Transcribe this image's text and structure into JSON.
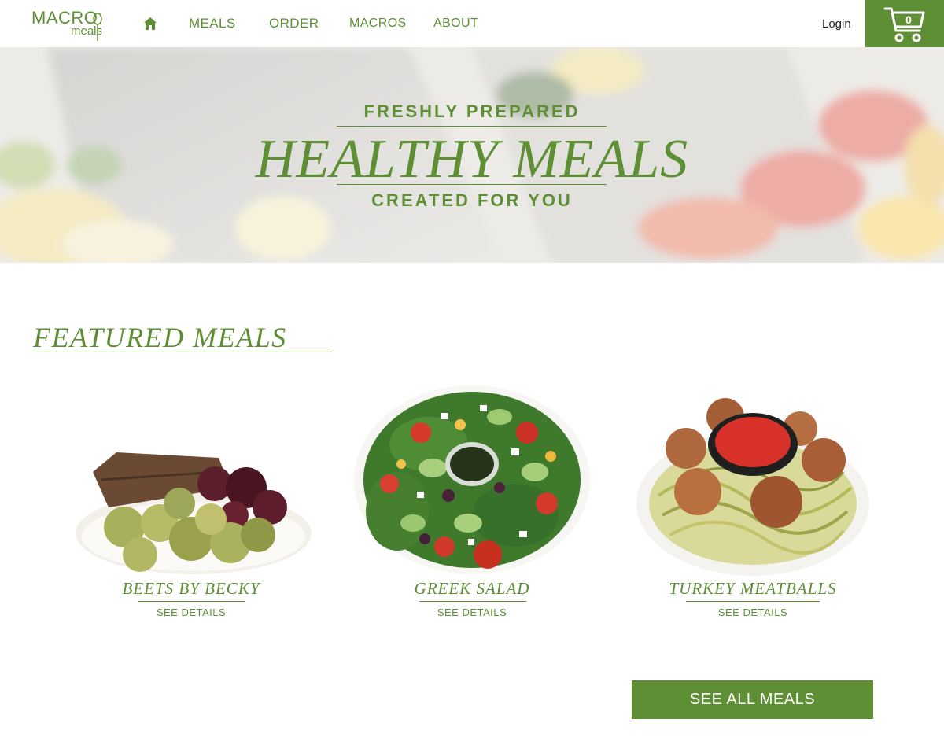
{
  "nav": {
    "logo_top": "MACRO",
    "logo_bottom": "meals",
    "links": [
      {
        "label": "MEALS"
      },
      {
        "label": "ORDER"
      },
      {
        "label": "MACROS"
      },
      {
        "label": "ABOUT"
      }
    ],
    "login_label": "Login",
    "cart_count": "0",
    "home_icon": "home-icon",
    "cart_icon": "shopping-cart-icon"
  },
  "hero": {
    "pre_title": "FRESHLY PREPARED",
    "title": "HEALTHY MEALS",
    "post_title": "CREATED FOR YOU"
  },
  "featured": {
    "heading": "FEATURED MEALS",
    "meals": [
      {
        "name": "BEETS BY BECKY",
        "details_label": "SEE DETAILS"
      },
      {
        "name": "GREEK SALAD",
        "details_label": "SEE DETAILS"
      },
      {
        "name": "TURKEY MEATBALLS",
        "details_label": "SEE DETAILS"
      }
    ],
    "see_all_label": "SEE ALL MEALS"
  },
  "colors": {
    "brand_green": "#5f8f35",
    "cart_background": "#5f8f35",
    "button_background": "#5f8f35"
  }
}
